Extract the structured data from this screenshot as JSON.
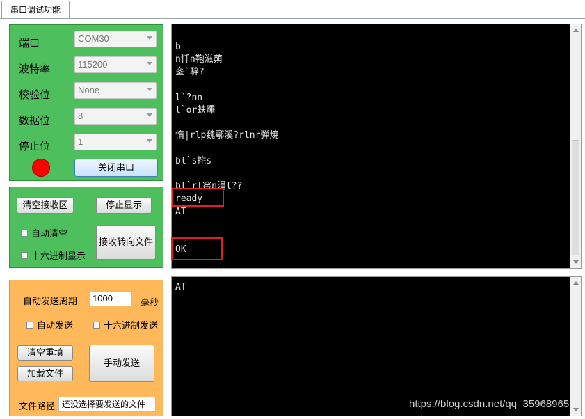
{
  "tab": {
    "label": "串口调试功能"
  },
  "serial_settings": {
    "port": {
      "label": "端口",
      "value": "COM30"
    },
    "baud": {
      "label": "波特率",
      "value": "115200"
    },
    "parity": {
      "label": "校验位",
      "value": "None"
    },
    "databits": {
      "label": "数据位",
      "value": "8"
    },
    "stopbits": {
      "label": "停止位",
      "value": "1"
    },
    "status_color": "#ff0000",
    "close_port_label": "关闭串口"
  },
  "receive_options": {
    "clear_receive_label": "清空接收区",
    "stop_display_label": "停止显示",
    "auto_clear_label": "自动清空",
    "hex_display_label": "十六进制显示",
    "receive_to_file_label": "接收转向文件"
  },
  "send_options": {
    "auto_send_period_label": "自动发送周期",
    "period_value": "1000",
    "ms_label": "毫秒",
    "auto_send_label": "自动发送",
    "hex_send_label": "十六进制发送",
    "clear_refill_label": "清空重填",
    "load_file_label": "加载文件",
    "manual_send_label": "手动发送",
    "file_path_label": "文件路径",
    "file_path_value": "还没选择要发送的文件"
  },
  "receive_area": {
    "lines": [
      "b",
      "n忏n鞄滋蒴",
      "銮`騂?",
      "",
      "l`?nn",
      "l`or蚨熚",
      "",
      "惰|rlp魏鄠溪?rlnr弹焼",
      "",
      "bl`s挓s",
      "",
      "bl`rl窑n涓l??",
      "ready",
      "AT",
      "",
      "",
      "OK"
    ]
  },
  "send_area": {
    "text": "AT"
  },
  "watermark": "https://blog.csdn.net/qq_35968965"
}
